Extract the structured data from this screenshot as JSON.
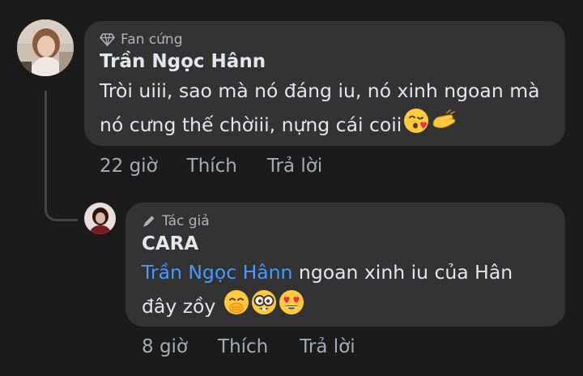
{
  "comment": {
    "badge": "Fan cứng",
    "author": "Trần Ngọc Hânn",
    "line1": "Tròi uiii, sao mà nó đáng iu, nó xinh ngoan mà",
    "line2": "nó cưng thế chờiii, nựng cái coii",
    "emojis": [
      "kissing-face-emoji",
      "pinching-hand-emoji"
    ],
    "time": "22 giờ",
    "like": "Thích",
    "reply": "Trả lời"
  },
  "reply": {
    "badge": "Tác giả",
    "author": "CARA",
    "mention": "Trần Ngọc Hânn",
    "text1": " ngoan xinh iu của Hân",
    "line2": "đây zồy",
    "emojis": [
      "face-with-hand-over-mouth-emoji",
      "nerd-face-emoji",
      "heart-eyes-emoji"
    ],
    "time": "8 giờ",
    "like": "Thích",
    "reply": "Trả lời"
  },
  "colors": {
    "background": "#1b1b1c",
    "bubble": "#333334",
    "mention": "#4599ff",
    "secondary_text": "#b0b3b8"
  }
}
